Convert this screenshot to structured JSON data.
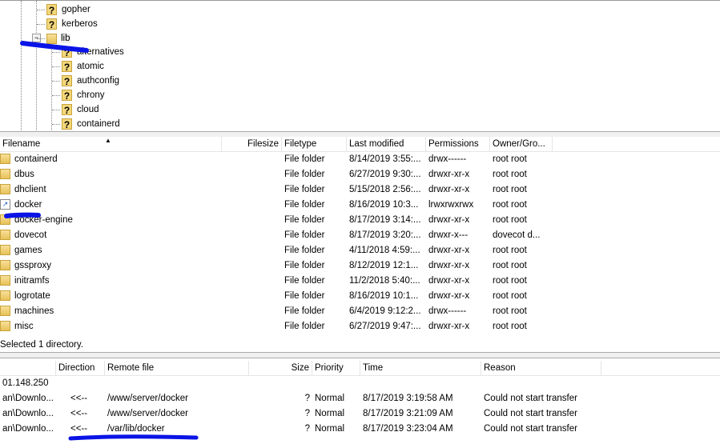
{
  "tree": {
    "items": [
      {
        "label": "gopher",
        "icon": "unknown-folder-icon"
      },
      {
        "label": "kerberos",
        "icon": "unknown-folder-icon"
      },
      {
        "label": "lib",
        "icon": "folder-icon",
        "expanded": true
      },
      {
        "label": "alternatives",
        "icon": "unknown-folder-icon"
      },
      {
        "label": "atomic",
        "icon": "unknown-folder-icon"
      },
      {
        "label": "authconfig",
        "icon": "unknown-folder-icon"
      },
      {
        "label": "chrony",
        "icon": "unknown-folder-icon"
      },
      {
        "label": "cloud",
        "icon": "unknown-folder-icon"
      },
      {
        "label": "containerd",
        "icon": "unknown-folder-icon"
      }
    ]
  },
  "filelist": {
    "columns": [
      "Filename",
      "Filesize",
      "Filetype",
      "Last modified",
      "Permissions",
      "Owner/Gro..."
    ],
    "rows": [
      {
        "name": "containerd",
        "size": "",
        "type": "File folder",
        "modified": "8/14/2019 3:55:...",
        "perms": "drwx------",
        "owner": "root root"
      },
      {
        "name": "dbus",
        "size": "",
        "type": "File folder",
        "modified": "6/27/2019 9:30:...",
        "perms": "drwxr-xr-x",
        "owner": "root root"
      },
      {
        "name": "dhclient",
        "size": "",
        "type": "File folder",
        "modified": "5/15/2018 2:56:...",
        "perms": "drwxr-xr-x",
        "owner": "root root"
      },
      {
        "name": "docker",
        "size": "",
        "type": "File folder",
        "modified": "8/16/2019 10:3...",
        "perms": "lrwxrwxrwx",
        "owner": "root root",
        "symlink": true
      },
      {
        "name": "docker-engine",
        "size": "",
        "type": "File folder",
        "modified": "8/17/2019 3:14:...",
        "perms": "drwxr-xr-x",
        "owner": "root root"
      },
      {
        "name": "dovecot",
        "size": "",
        "type": "File folder",
        "modified": "8/17/2019 3:20:...",
        "perms": "drwxr-x---",
        "owner": "dovecot d..."
      },
      {
        "name": "games",
        "size": "",
        "type": "File folder",
        "modified": "4/11/2018 4:59:...",
        "perms": "drwxr-xr-x",
        "owner": "root root"
      },
      {
        "name": "gssproxy",
        "size": "",
        "type": "File folder",
        "modified": "8/12/2019 12:1...",
        "perms": "drwxr-xr-x",
        "owner": "root root"
      },
      {
        "name": "initramfs",
        "size": "",
        "type": "File folder",
        "modified": "11/2/2018 5:40:...",
        "perms": "drwxr-xr-x",
        "owner": "root root"
      },
      {
        "name": "logrotate",
        "size": "",
        "type": "File folder",
        "modified": "8/16/2019 10:1...",
        "perms": "drwxr-xr-x",
        "owner": "root root"
      },
      {
        "name": "machines",
        "size": "",
        "type": "File folder",
        "modified": "6/4/2019 9:12:2...",
        "perms": "drwx------",
        "owner": "root root"
      },
      {
        "name": "misc",
        "size": "",
        "type": "File folder",
        "modified": "6/27/2019 9:47:...",
        "perms": "drwxr-xr-x",
        "owner": "root root"
      }
    ],
    "status": "Selected 1 directory."
  },
  "queue": {
    "columns": [
      "",
      "Direction",
      "Remote file",
      "Size",
      "Priority",
      "Time",
      "Reason"
    ],
    "server": "01.148.250",
    "rows": [
      {
        "local": "an\\Downlo...",
        "direction": "<<--",
        "remote": "/www/server/docker",
        "size": "?",
        "priority": "Normal",
        "time": "8/17/2019 3:19:58 AM",
        "reason": "Could not start transfer"
      },
      {
        "local": "an\\Downlo...",
        "direction": "<<--",
        "remote": "/www/server/docker",
        "size": "?",
        "priority": "Normal",
        "time": "8/17/2019 3:21:09 AM",
        "reason": "Could not start transfer"
      },
      {
        "local": "an\\Downlo...",
        "direction": "<<--",
        "remote": "/var/lib/docker",
        "size": "?",
        "priority": "Normal",
        "time": "8/17/2019 3:23:04 AM",
        "reason": "Could not start transfer"
      }
    ]
  },
  "colors": {
    "marker": "#0a14e6"
  }
}
